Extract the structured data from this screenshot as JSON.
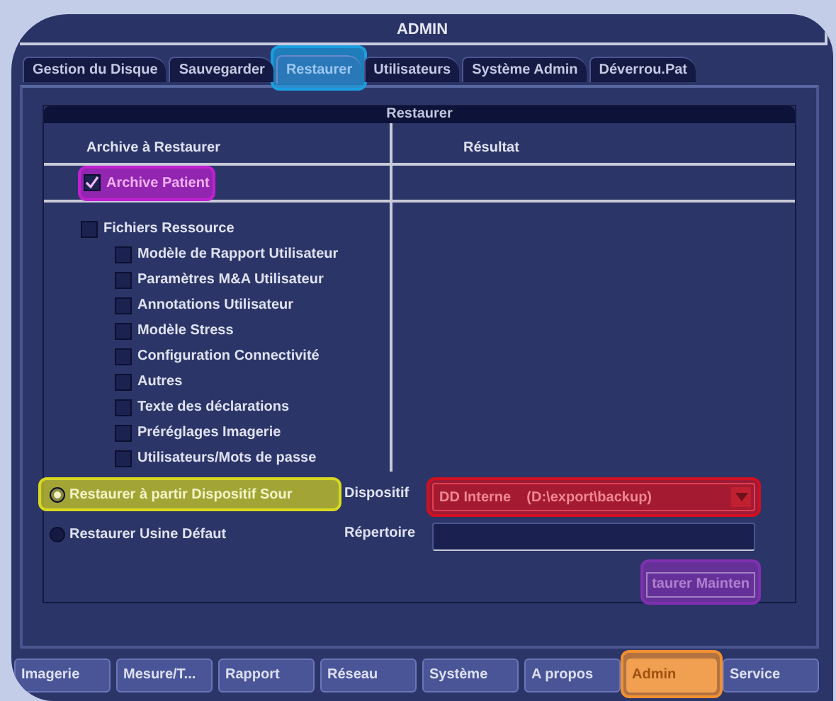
{
  "window": {
    "title": "ADMIN"
  },
  "tabs": [
    {
      "label": "Gestion du Disque",
      "selected": false
    },
    {
      "label": "Sauvegarder",
      "selected": false
    },
    {
      "label": "Restaurer",
      "selected": true,
      "color": "#1a9ee0"
    },
    {
      "label": "Utilisateurs",
      "selected": false
    },
    {
      "label": "Système Admin",
      "selected": false
    },
    {
      "label": "Déverrou.Pat",
      "selected": false
    }
  ],
  "panel": {
    "title": "Restaurer",
    "columns": [
      "Archive à Restaurer",
      "Résultat"
    ],
    "archive": {
      "label": "Archive Patient",
      "checked": true,
      "color": "#c020d0"
    },
    "resource": {
      "label": "Fichiers Ressource",
      "checked": false,
      "children": [
        {
          "label": "Modèle de Rapport Utilisateur",
          "checked": false
        },
        {
          "label": "Paramètres M&A Utilisateur",
          "checked": false
        },
        {
          "label": "Annotations Utilisateur",
          "checked": false
        },
        {
          "label": "Modèle Stress",
          "checked": false
        },
        {
          "label": "Configuration Connectivité",
          "checked": false
        },
        {
          "label": "Autres",
          "checked": false
        },
        {
          "label": "Texte des déclarations",
          "checked": false
        },
        {
          "label": "Préréglages Imagerie",
          "checked": false
        },
        {
          "label": "Utilisateurs/Mots de passe",
          "checked": false
        }
      ]
    },
    "source_options": [
      {
        "label": "Restaurer à partir Dispositif Sour",
        "selected": true,
        "color": "#d8d820"
      },
      {
        "label": "Restaurer Usine Défaut",
        "selected": false
      }
    ],
    "device": {
      "label": "Dispositif",
      "value": "DD Interne    (D:\\export\\backup)",
      "color": "#d01020"
    },
    "directory": {
      "label": "Répertoire"
    },
    "action_button": {
      "label": "taurer Mainten",
      "color": "#8030b0"
    }
  },
  "bottom_tabs": [
    {
      "label": "Imagerie",
      "selected": false
    },
    {
      "label": "Mesure/T...",
      "selected": false
    },
    {
      "label": "Rapport",
      "selected": false
    },
    {
      "label": "Réseau",
      "selected": false
    },
    {
      "label": "Système",
      "selected": false
    },
    {
      "label": "A propos",
      "selected": false
    },
    {
      "label": "Admin",
      "selected": true,
      "color": "#f09030"
    },
    {
      "label": "Service",
      "selected": false
    }
  ]
}
